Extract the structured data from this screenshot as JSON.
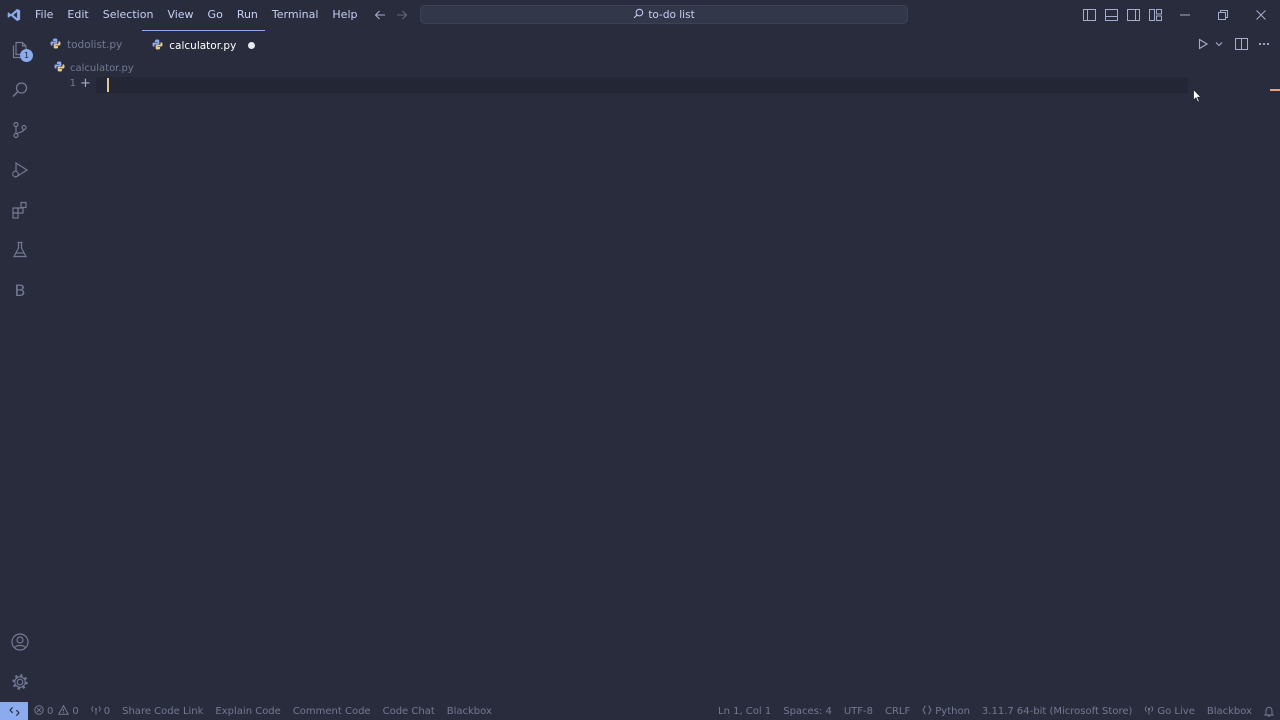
{
  "menu": [
    "File",
    "Edit",
    "Selection",
    "View",
    "Go",
    "Run",
    "Terminal",
    "Help"
  ],
  "search": {
    "text": "to-do list"
  },
  "activity": {
    "explorer_badge": "1",
    "blackbox_letter": "B"
  },
  "tabs": [
    {
      "label": "todolist.py",
      "active": false
    },
    {
      "label": "calculator.py",
      "active": true,
      "dirty": true
    }
  ],
  "breadcrumb": {
    "file": "calculator.py"
  },
  "editor": {
    "line_number": "1",
    "fold_glyph": "+"
  },
  "status": {
    "errors": "0",
    "warnings": "0",
    "ports": "0",
    "left_items": [
      "Share Code Link",
      "Explain Code",
      "Comment Code",
      "Code Chat",
      "Blackbox"
    ],
    "position": "Ln 1, Col 1",
    "spaces": "Spaces: 4",
    "encoding": "UTF-8",
    "eol": "CRLF",
    "language": "Python",
    "interpreter": "3.11.7 64-bit (Microsoft Store)",
    "go_live": "Go Live",
    "blackbox": "Blackbox"
  },
  "colors": {
    "accent": "#8caaee",
    "background": "#292c3c",
    "cursor": "#e5c890",
    "python_icon": "#e5c890"
  }
}
